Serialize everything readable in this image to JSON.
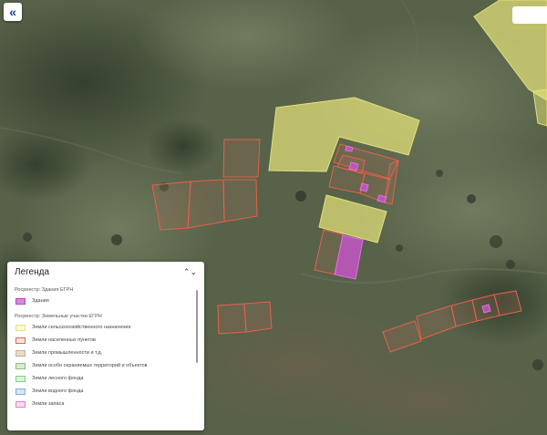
{
  "map": {
    "collapse_label": "«",
    "colors": {
      "agri_fill": "#e8e57a",
      "agri_stroke": "#e3e07a",
      "settlement_stroke": "#e8604c",
      "building_fill": "#d054d6",
      "building_stroke": "#e070e0"
    }
  },
  "legend": {
    "title": "Легенда",
    "toggle_icon": "chevron-up-down",
    "toggle_glyph": "⌃⌄",
    "groups": [
      {
        "title": "Росреестр: Здания ЕГРН",
        "items": [
          {
            "label": "Здания",
            "fill": "#d58ad9",
            "border": "#c040c8"
          }
        ]
      },
      {
        "title": "Росреестр: Земельные участки ЕГРН",
        "items": [
          {
            "label": "Земли сельскохозяйственного назначения",
            "fill": "#fafad4",
            "border": "#e2e08a"
          },
          {
            "label": "Земли населенных пунктов",
            "fill": "#fbe3de",
            "border": "#e8604c"
          },
          {
            "label": "Земли промышленности и т.д.",
            "fill": "#e9dcc8",
            "border": "#c4b08a"
          },
          {
            "label": "Земли особо охраняемых территорий и объектов",
            "fill": "#d6ecd0",
            "border": "#8cc07a"
          },
          {
            "label": "Земли лесного фонда",
            "fill": "#d9f2d8",
            "border": "#84cc84"
          },
          {
            "label": "Земли водного фонда",
            "fill": "#d7e6f6",
            "border": "#84aedc"
          },
          {
            "label": "Земли запаса",
            "fill": "#f6dcef",
            "border": "#d884c8"
          }
        ]
      }
    ]
  }
}
